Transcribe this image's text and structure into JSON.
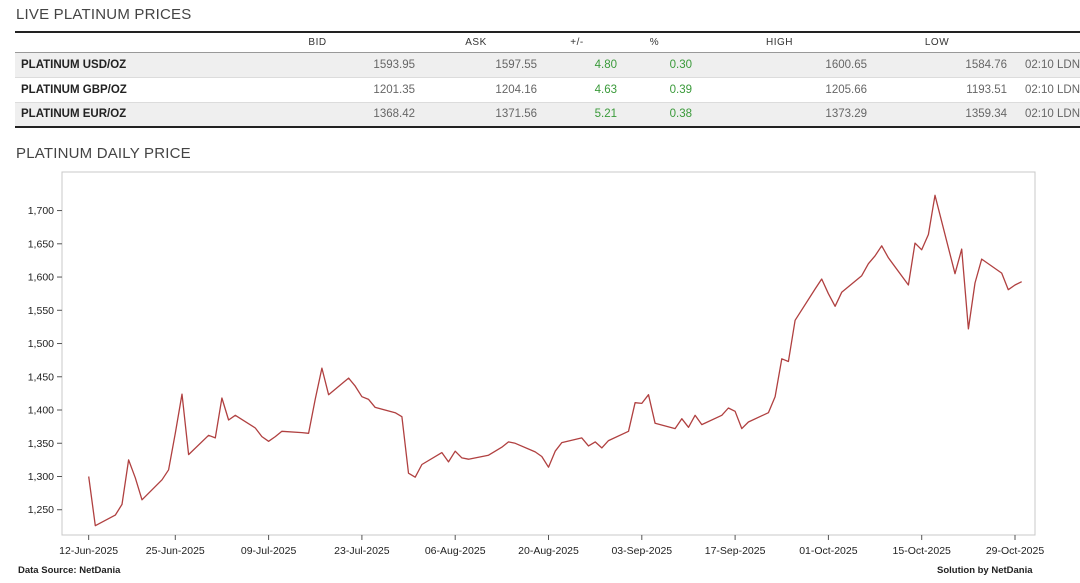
{
  "live_title": "LIVE PLATINUM PRICES",
  "daily_title": "PLATINUM DAILY PRICE",
  "table": {
    "headers": [
      "",
      "BID",
      "ASK",
      "+/-",
      "%",
      "HIGH",
      "LOW",
      ""
    ],
    "rows": [
      {
        "name": "PLATINUM USD/OZ",
        "bid": "1593.95",
        "ask": "1597.55",
        "change": "4.80",
        "pct": "0.30",
        "high": "1600.65",
        "low": "1584.76",
        "time": "02:10 LDN"
      },
      {
        "name": "PLATINUM GBP/OZ",
        "bid": "1201.35",
        "ask": "1204.16",
        "change": "4.63",
        "pct": "0.39",
        "high": "1205.66",
        "low": "1193.51",
        "time": "02:10 LDN"
      },
      {
        "name": "PLATINUM EUR/OZ",
        "bid": "1368.42",
        "ask": "1371.56",
        "change": "5.21",
        "pct": "0.38",
        "high": "1373.29",
        "low": "1359.34",
        "time": "02:10 LDN"
      }
    ]
  },
  "footer": {
    "source": "Data Source: NetDania",
    "solution": "Solution by NetDania"
  },
  "colors": {
    "line": "#b04040",
    "positive": "#3a9a3a"
  },
  "chart_data": {
    "type": "line",
    "x_axis_type": "date",
    "xlim": [
      "2025-06-08",
      "2025-11-01"
    ],
    "ylim": [
      1212,
      1758
    ],
    "y_ticks": [
      1250,
      1300,
      1350,
      1400,
      1450,
      1500,
      1550,
      1600,
      1650,
      1700
    ],
    "y_tick_labels": [
      "1,250",
      "1,300",
      "1,350",
      "1,400",
      "1,450",
      "1,500",
      "1,550",
      "1,600",
      "1,650",
      "1,700"
    ],
    "x_ticks": [
      "2025-06-12",
      "2025-06-25",
      "2025-07-09",
      "2025-07-23",
      "2025-08-06",
      "2025-08-20",
      "2025-09-03",
      "2025-09-17",
      "2025-10-01",
      "2025-10-15",
      "2025-10-29"
    ],
    "x_tick_labels": [
      "12-Jun-2025",
      "25-Jun-2025",
      "09-Jul-2025",
      "23-Jul-2025",
      "06-Aug-2025",
      "20-Aug-2025",
      "03-Sep-2025",
      "17-Sep-2025",
      "01-Oct-2025",
      "15-Oct-2025",
      "29-Oct-2025"
    ],
    "grid": false,
    "series": [
      {
        "x": [
          "2025-06-12",
          "2025-06-13",
          "2025-06-16",
          "2025-06-17",
          "2025-06-18",
          "2025-06-19",
          "2025-06-20",
          "2025-06-23",
          "2025-06-24",
          "2025-06-25",
          "2025-06-26",
          "2025-06-27",
          "2025-06-30",
          "2025-07-01",
          "2025-07-02",
          "2025-07-03",
          "2025-07-04",
          "2025-07-07",
          "2025-07-08",
          "2025-07-09",
          "2025-07-10",
          "2025-07-11",
          "2025-07-14",
          "2025-07-15",
          "2025-07-16",
          "2025-07-17",
          "2025-07-18",
          "2025-07-21",
          "2025-07-22",
          "2025-07-23",
          "2025-07-24",
          "2025-07-25",
          "2025-07-28",
          "2025-07-29",
          "2025-07-30",
          "2025-07-31",
          "2025-08-01",
          "2025-08-04",
          "2025-08-05",
          "2025-08-06",
          "2025-08-07",
          "2025-08-08",
          "2025-08-11",
          "2025-08-12",
          "2025-08-13",
          "2025-08-14",
          "2025-08-15",
          "2025-08-18",
          "2025-08-19",
          "2025-08-20",
          "2025-08-21",
          "2025-08-22",
          "2025-08-25",
          "2025-08-26",
          "2025-08-27",
          "2025-08-28",
          "2025-08-29",
          "2025-09-01",
          "2025-09-02",
          "2025-09-03",
          "2025-09-04",
          "2025-09-05",
          "2025-09-08",
          "2025-09-09",
          "2025-09-10",
          "2025-09-11",
          "2025-09-12",
          "2025-09-15",
          "2025-09-16",
          "2025-09-17",
          "2025-09-18",
          "2025-09-19",
          "2025-09-22",
          "2025-09-23",
          "2025-09-24",
          "2025-09-25",
          "2025-09-26",
          "2025-09-29",
          "2025-09-30",
          "2025-10-01",
          "2025-10-02",
          "2025-10-03",
          "2025-10-06",
          "2025-10-07",
          "2025-10-08",
          "2025-10-09",
          "2025-10-10",
          "2025-10-13",
          "2025-10-14",
          "2025-10-15",
          "2025-10-16",
          "2025-10-17",
          "2025-10-20",
          "2025-10-21",
          "2025-10-22",
          "2025-10-23",
          "2025-10-24",
          "2025-10-27",
          "2025-10-28",
          "2025-10-29",
          "2025-10-30"
        ],
        "y": [
          1300,
          1226,
          1242,
          1258,
          1325,
          1298,
          1265,
          1295,
          1310,
          1365,
          1424,
          1333,
          1362,
          1358,
          1418,
          1385,
          1392,
          1373,
          1360,
          1353,
          1360,
          1368,
          1366,
          1365,
          1416,
          1463,
          1423,
          1448,
          1436,
          1420,
          1416,
          1404,
          1396,
          1390,
          1305,
          1299,
          1318,
          1336,
          1322,
          1338,
          1328,
          1326,
          1332,
          1338,
          1344,
          1352,
          1350,
          1337,
          1330,
          1314,
          1338,
          1351,
          1358,
          1346,
          1352,
          1343,
          1354,
          1368,
          1411,
          1410,
          1423,
          1380,
          1372,
          1387,
          1374,
          1392,
          1378,
          1392,
          1403,
          1398,
          1372,
          1382,
          1396,
          1420,
          1477,
          1473,
          1535,
          1582,
          1597,
          1575,
          1556,
          1577,
          1602,
          1620,
          1632,
          1647,
          1629,
          1588,
          1651,
          1641,
          1664,
          1723,
          1605,
          1642,
          1522,
          1591,
          1627,
          1606,
          1581,
          1588,
          1593
        ]
      }
    ]
  }
}
